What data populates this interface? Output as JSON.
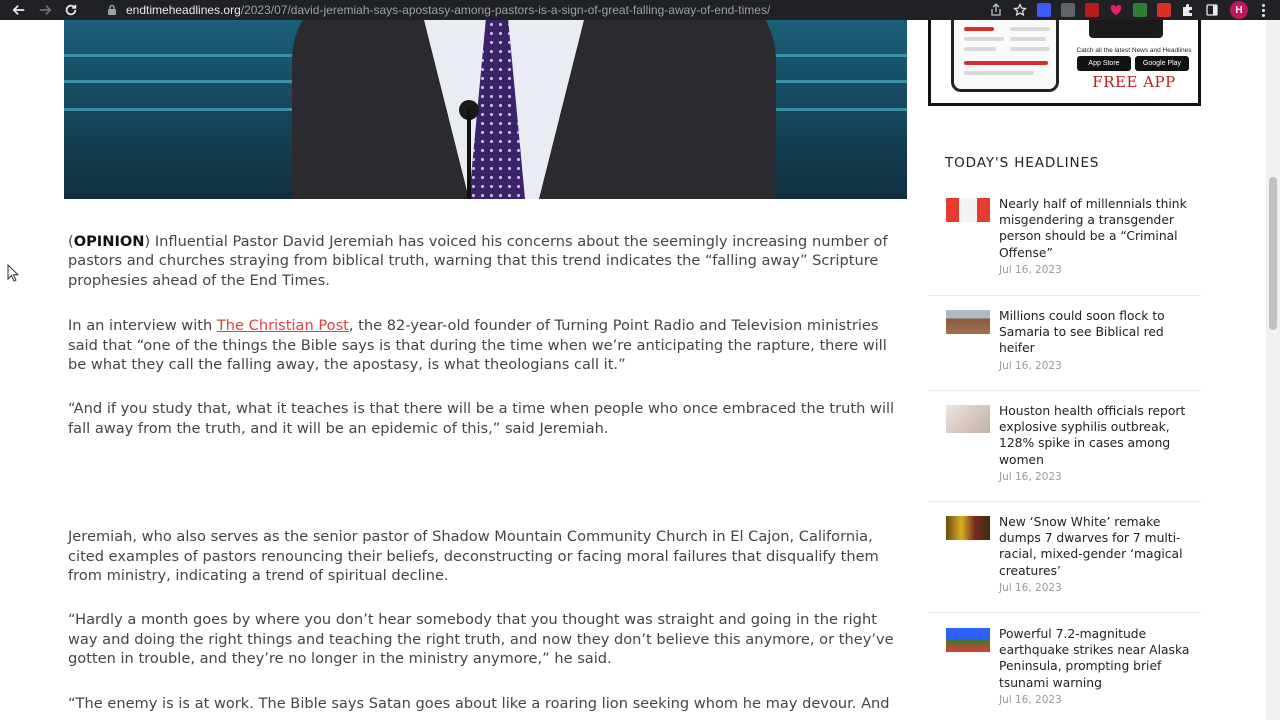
{
  "browser": {
    "url_domain": "endtimeheadlines.org",
    "url_path": "/2023/07/david-jeremiah-says-apostasy-among-pastors-is-a-sign-of-great-falling-away-of-end-times/",
    "profile_initial": "H",
    "colors": {
      "bar": "#202124",
      "profile": "#c2185b"
    }
  },
  "ad": {
    "tagline": "Catch all the latest News and Headlines",
    "app_store": "App Store",
    "google_play": "Google Play",
    "free_app": "FREE APP"
  },
  "article": {
    "p1": {
      "open_paren": "(",
      "label": "OPINION",
      "rest": ") Influential Pastor David Jeremiah has voiced his concerns about the seemingly increasing number of pastors and churches straying from biblical truth, warning that this trend indicates the “falling away” Scripture prophesies ahead of the End Times."
    },
    "p2": {
      "before": "In an interview with ",
      "link": "The Christian Post",
      "after": ", the 82-year-old founder of Turning Point Radio and Television ministries said that “one of the things the Bible says is that during the time when we’re anticipating the rapture, there will be what they call the falling away, the apostasy, is what theologians call it.”"
    },
    "p3": "“And if you study that, what it teaches is that there will be a time when people who once embraced the truth will fall away from the truth, and it will be an epidemic of this,” said Jeremiah.",
    "p4": "Jeremiah, who also serves as the senior pastor of Shadow Mountain Community Church in El Cajon, California, cited examples of pastors renouncing their beliefs, deconstructing or facing moral failures that disqualify them from ministry, indicating a trend of spiritual decline.",
    "p5": "“Hardly a month goes by where you don’t hear somebody that you thought was straight and going in the right way and doing the right things and teaching the right truth, and now they don’t believe this anymore, or they’ve gotten in trouble, and they’re no longer in the ministry anymore,” he said.",
    "p6": "“The enemy is is at work. The Bible says Satan goes about like a roaring lion seeking whom he may devour. And",
    "link_color": "#e0403f"
  },
  "sidebar": {
    "headlines_title": "TODAY'S HEADLINES",
    "headlines": [
      {
        "title": "Nearly half of millennials think misgendering a transgender person should be a “Criminal Offense”",
        "date": "Jul 16, 2023"
      },
      {
        "title": "Millions could soon flock to Samaria to see Biblical red heifer",
        "date": "Jul 16, 2023"
      },
      {
        "title": "Houston health officials report explosive syphilis outbreak, 128% spike in cases among women",
        "date": "Jul 16, 2023"
      },
      {
        "title": "New ‘Snow White’ remake dumps 7 dwarves for 7 multi-racial, mixed-gender ‘magical creatures’",
        "date": "Jul 16, 2023"
      },
      {
        "title": "Powerful 7.2-magnitude earthquake strikes near Alaska Peninsula, prompting brief tsunami warning",
        "date": "Jul 16, 2023"
      }
    ]
  }
}
